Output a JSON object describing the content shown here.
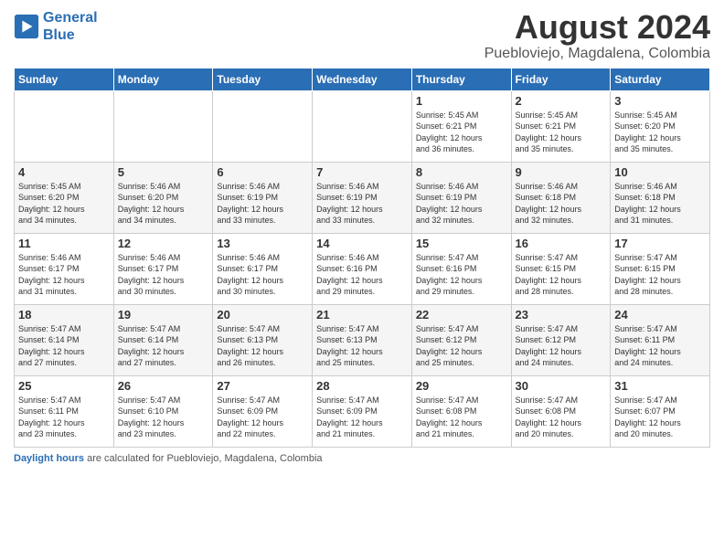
{
  "logo": {
    "line1": "General",
    "line2": "Blue"
  },
  "title": "August 2024",
  "subtitle": "Puebloviejo, Magdalena, Colombia",
  "header": {
    "days": [
      "Sunday",
      "Monday",
      "Tuesday",
      "Wednesday",
      "Thursday",
      "Friday",
      "Saturday"
    ]
  },
  "weeks": [
    [
      {
        "num": "",
        "info": ""
      },
      {
        "num": "",
        "info": ""
      },
      {
        "num": "",
        "info": ""
      },
      {
        "num": "",
        "info": ""
      },
      {
        "num": "1",
        "info": "Sunrise: 5:45 AM\nSunset: 6:21 PM\nDaylight: 12 hours\nand 36 minutes."
      },
      {
        "num": "2",
        "info": "Sunrise: 5:45 AM\nSunset: 6:21 PM\nDaylight: 12 hours\nand 35 minutes."
      },
      {
        "num": "3",
        "info": "Sunrise: 5:45 AM\nSunset: 6:20 PM\nDaylight: 12 hours\nand 35 minutes."
      }
    ],
    [
      {
        "num": "4",
        "info": "Sunrise: 5:45 AM\nSunset: 6:20 PM\nDaylight: 12 hours\nand 34 minutes."
      },
      {
        "num": "5",
        "info": "Sunrise: 5:46 AM\nSunset: 6:20 PM\nDaylight: 12 hours\nand 34 minutes."
      },
      {
        "num": "6",
        "info": "Sunrise: 5:46 AM\nSunset: 6:19 PM\nDaylight: 12 hours\nand 33 minutes."
      },
      {
        "num": "7",
        "info": "Sunrise: 5:46 AM\nSunset: 6:19 PM\nDaylight: 12 hours\nand 33 minutes."
      },
      {
        "num": "8",
        "info": "Sunrise: 5:46 AM\nSunset: 6:19 PM\nDaylight: 12 hours\nand 32 minutes."
      },
      {
        "num": "9",
        "info": "Sunrise: 5:46 AM\nSunset: 6:18 PM\nDaylight: 12 hours\nand 32 minutes."
      },
      {
        "num": "10",
        "info": "Sunrise: 5:46 AM\nSunset: 6:18 PM\nDaylight: 12 hours\nand 31 minutes."
      }
    ],
    [
      {
        "num": "11",
        "info": "Sunrise: 5:46 AM\nSunset: 6:17 PM\nDaylight: 12 hours\nand 31 minutes."
      },
      {
        "num": "12",
        "info": "Sunrise: 5:46 AM\nSunset: 6:17 PM\nDaylight: 12 hours\nand 30 minutes."
      },
      {
        "num": "13",
        "info": "Sunrise: 5:46 AM\nSunset: 6:17 PM\nDaylight: 12 hours\nand 30 minutes."
      },
      {
        "num": "14",
        "info": "Sunrise: 5:46 AM\nSunset: 6:16 PM\nDaylight: 12 hours\nand 29 minutes."
      },
      {
        "num": "15",
        "info": "Sunrise: 5:47 AM\nSunset: 6:16 PM\nDaylight: 12 hours\nand 29 minutes."
      },
      {
        "num": "16",
        "info": "Sunrise: 5:47 AM\nSunset: 6:15 PM\nDaylight: 12 hours\nand 28 minutes."
      },
      {
        "num": "17",
        "info": "Sunrise: 5:47 AM\nSunset: 6:15 PM\nDaylight: 12 hours\nand 28 minutes."
      }
    ],
    [
      {
        "num": "18",
        "info": "Sunrise: 5:47 AM\nSunset: 6:14 PM\nDaylight: 12 hours\nand 27 minutes."
      },
      {
        "num": "19",
        "info": "Sunrise: 5:47 AM\nSunset: 6:14 PM\nDaylight: 12 hours\nand 27 minutes."
      },
      {
        "num": "20",
        "info": "Sunrise: 5:47 AM\nSunset: 6:13 PM\nDaylight: 12 hours\nand 26 minutes."
      },
      {
        "num": "21",
        "info": "Sunrise: 5:47 AM\nSunset: 6:13 PM\nDaylight: 12 hours\nand 25 minutes."
      },
      {
        "num": "22",
        "info": "Sunrise: 5:47 AM\nSunset: 6:12 PM\nDaylight: 12 hours\nand 25 minutes."
      },
      {
        "num": "23",
        "info": "Sunrise: 5:47 AM\nSunset: 6:12 PM\nDaylight: 12 hours\nand 24 minutes."
      },
      {
        "num": "24",
        "info": "Sunrise: 5:47 AM\nSunset: 6:11 PM\nDaylight: 12 hours\nand 24 minutes."
      }
    ],
    [
      {
        "num": "25",
        "info": "Sunrise: 5:47 AM\nSunset: 6:11 PM\nDaylight: 12 hours\nand 23 minutes."
      },
      {
        "num": "26",
        "info": "Sunrise: 5:47 AM\nSunset: 6:10 PM\nDaylight: 12 hours\nand 23 minutes."
      },
      {
        "num": "27",
        "info": "Sunrise: 5:47 AM\nSunset: 6:09 PM\nDaylight: 12 hours\nand 22 minutes."
      },
      {
        "num": "28",
        "info": "Sunrise: 5:47 AM\nSunset: 6:09 PM\nDaylight: 12 hours\nand 21 minutes."
      },
      {
        "num": "29",
        "info": "Sunrise: 5:47 AM\nSunset: 6:08 PM\nDaylight: 12 hours\nand 21 minutes."
      },
      {
        "num": "30",
        "info": "Sunrise: 5:47 AM\nSunset: 6:08 PM\nDaylight: 12 hours\nand 20 minutes."
      },
      {
        "num": "31",
        "info": "Sunrise: 5:47 AM\nSunset: 6:07 PM\nDaylight: 12 hours\nand 20 minutes."
      }
    ]
  ],
  "footer": {
    "label": "Daylight hours",
    "description": " are calculated for Puebloviejo, Magdalena, Colombia"
  },
  "colors": {
    "header_bg": "#2a6eb5",
    "logo_blue": "#2a6eb5"
  }
}
